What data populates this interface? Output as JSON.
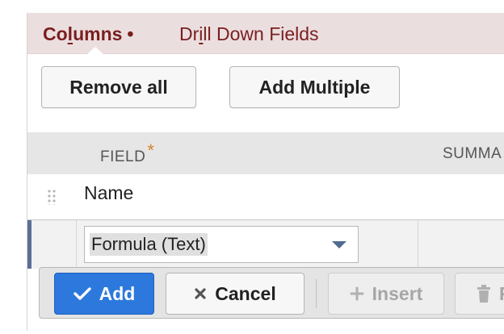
{
  "tabs": {
    "active_prefix": "Co",
    "active_underlined": "l",
    "active_suffix": "umns",
    "active_marker": "•",
    "drill_prefix": "Dr",
    "drill_underlined": "i",
    "drill_suffix": "ll Down Fields"
  },
  "toolbar": {
    "remove_all_label": "Remove all",
    "add_multiple_label": "Add Multiple"
  },
  "table": {
    "columns": [
      {
        "label": "FIELD",
        "required_marker": "*"
      },
      {
        "label": "SUMMA"
      }
    ],
    "rows": [
      {
        "field": "Name"
      }
    ]
  },
  "editor": {
    "field_select_value": "Formula (Text)"
  },
  "actions": {
    "add_label": "Add",
    "cancel_label": "Cancel",
    "insert_label": "Insert",
    "remove_label": "R"
  },
  "colors": {
    "tab_text": "#7a1f1f",
    "tab_bar": "#ebdedf",
    "primary": "#2d78dd",
    "required": "#d3852a",
    "row_marker": "#5b6f96"
  },
  "icons": {
    "add": "checkmark-icon",
    "cancel": "x-icon",
    "insert": "plus-icon",
    "remove": "trash-icon",
    "select": "caret-down-icon",
    "drag": "drag-handle-icon"
  }
}
